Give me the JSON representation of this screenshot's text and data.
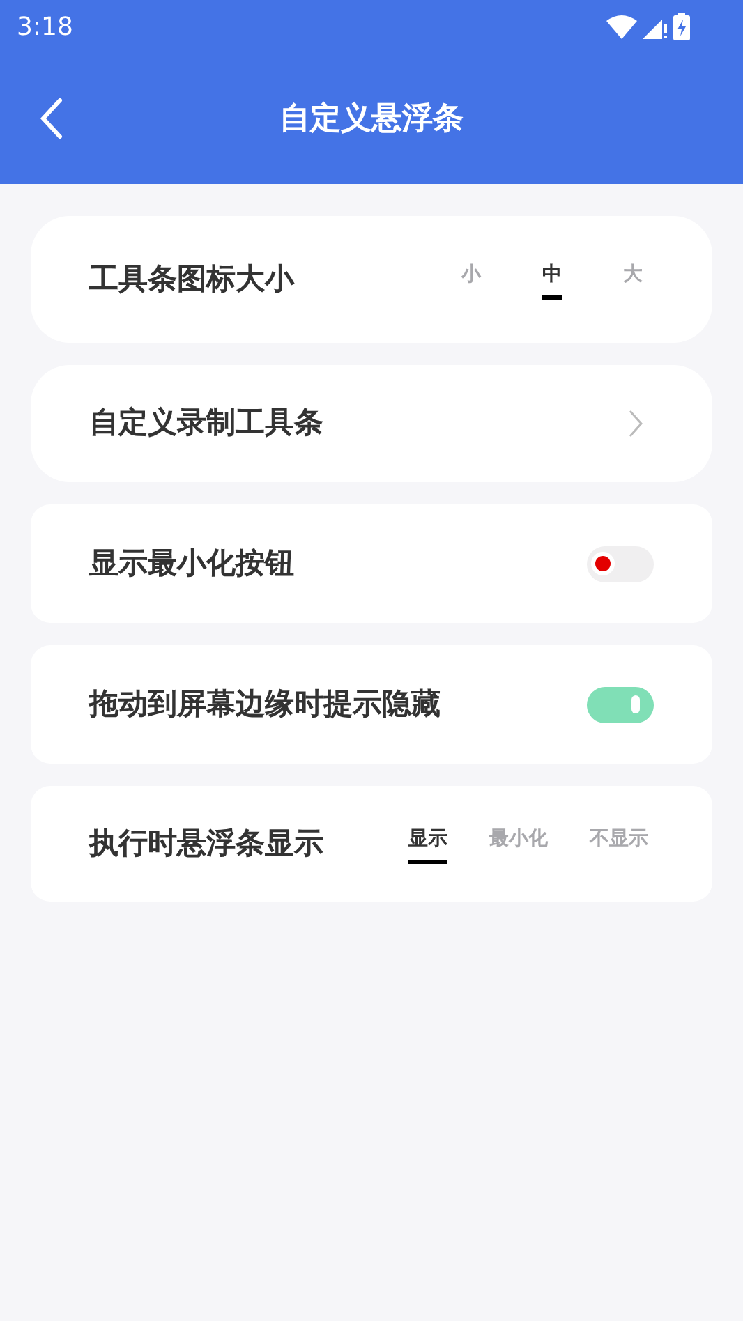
{
  "status_bar": {
    "time": "3:18"
  },
  "header": {
    "title": "自定义悬浮条"
  },
  "rows": [
    {
      "kind": "segmented",
      "label": "工具条图标大小",
      "options": [
        {
          "label": "小",
          "selected": false
        },
        {
          "label": "中",
          "selected": true
        },
        {
          "label": "大",
          "selected": false
        }
      ]
    },
    {
      "kind": "link",
      "label": "自定义录制工具条"
    },
    {
      "kind": "toggle",
      "label": "显示最小化按钮",
      "on": false
    },
    {
      "kind": "toggle",
      "label": "拖动到屏幕边缘时提示隐藏",
      "on": true
    },
    {
      "kind": "segmented",
      "label": "执行时悬浮条显示",
      "options": [
        {
          "label": "显示",
          "selected": true
        },
        {
          "label": "最小化",
          "selected": false
        },
        {
          "label": "不显示",
          "selected": false
        }
      ]
    }
  ]
}
